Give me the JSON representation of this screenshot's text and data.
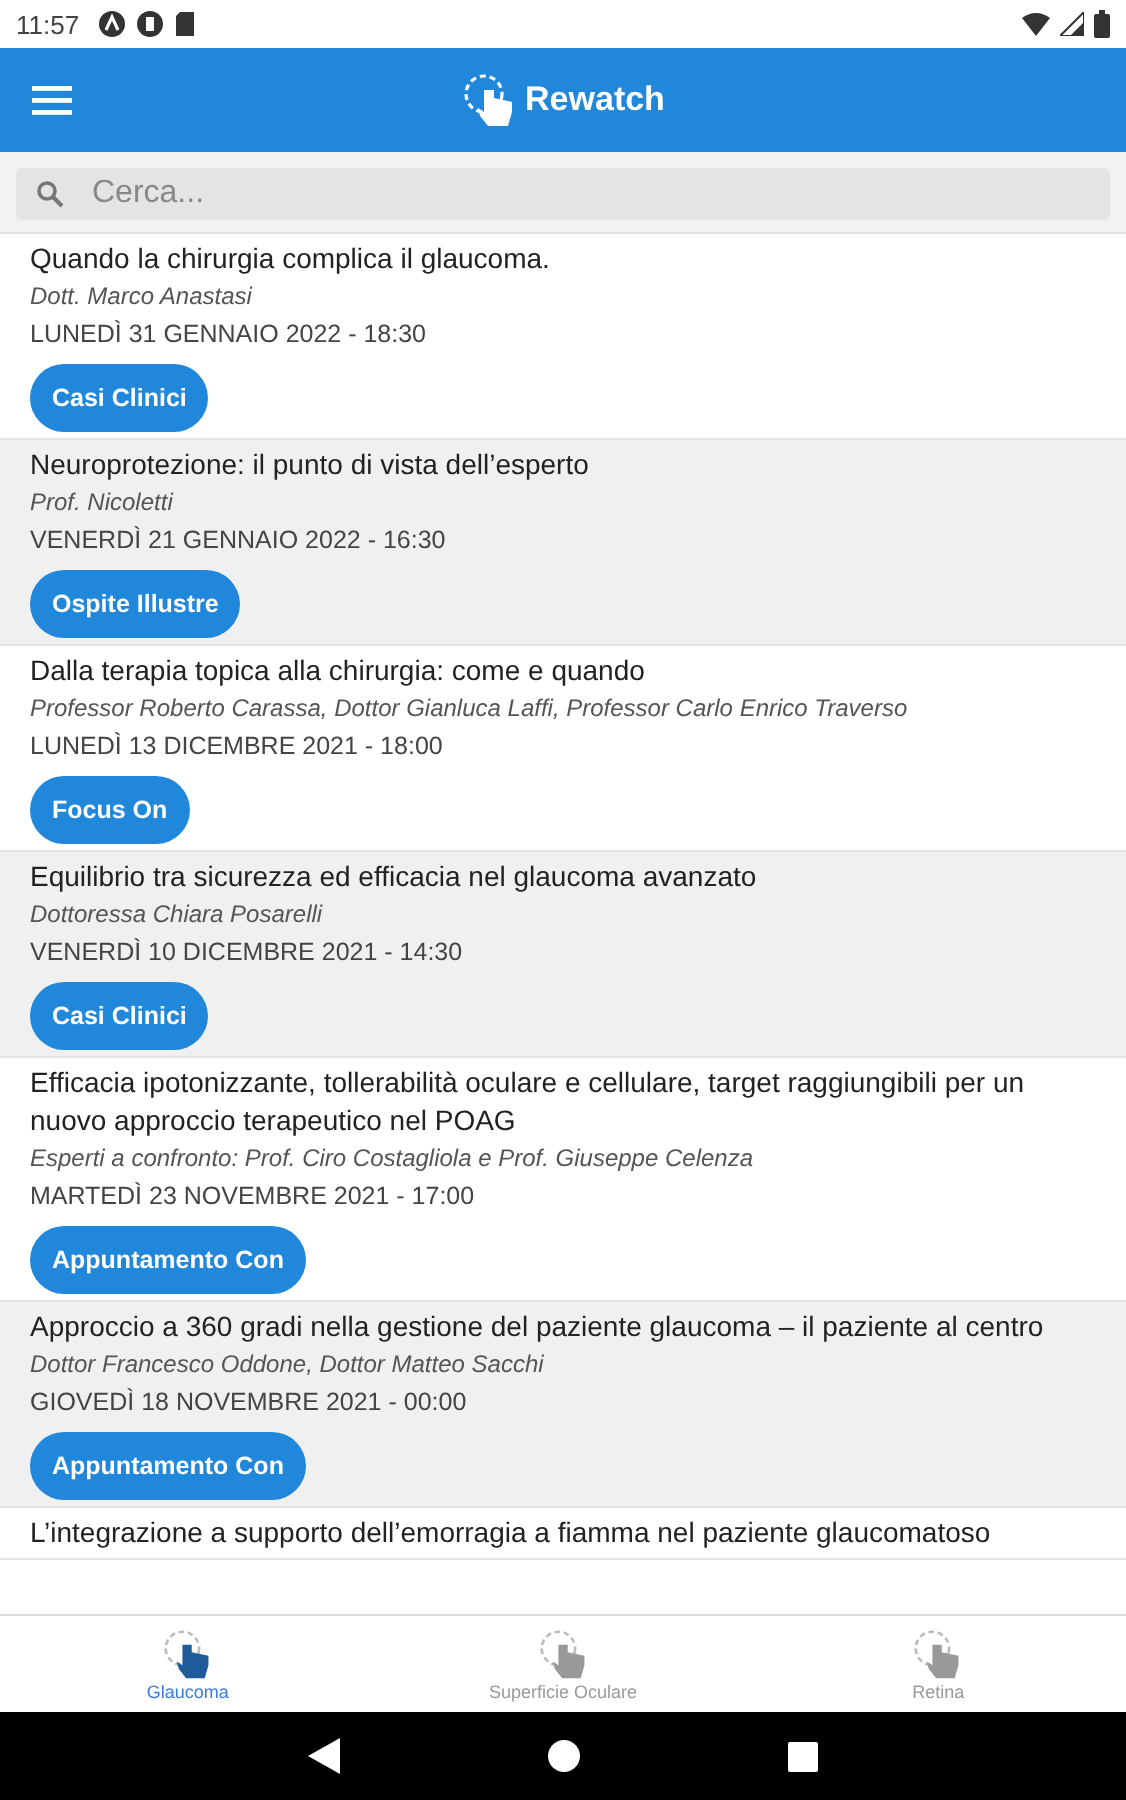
{
  "status_bar": {
    "time": "11:57"
  },
  "app_bar": {
    "title": "Rewatch"
  },
  "search": {
    "placeholder": "Cerca..."
  },
  "events": [
    {
      "title": "Quando la chirurgia complica il glaucoma.",
      "speaker": "Dott. Marco Anastasi",
      "date": "LUNEDÌ 31 GENNAIO 2022 - 18:30",
      "tag": "Casi Clinici"
    },
    {
      "title": "Neuroprotezione: il punto di vista dell’esperto",
      "speaker": "Prof. Nicoletti",
      "date": "VENERDÌ 21 GENNAIO 2022 - 16:30",
      "tag": "Ospite Illustre"
    },
    {
      "title": "Dalla terapia topica alla chirurgia: come e quando",
      "speaker": "Professor Roberto Carassa, Dottor Gianluca Laffi, Professor Carlo Enrico Traverso",
      "date": "LUNEDÌ 13 DICEMBRE 2021 - 18:00",
      "tag": "Focus On"
    },
    {
      "title": "Equilibrio tra sicurezza ed efficacia nel glaucoma avanzato",
      "speaker": "Dottoressa Chiara Posarelli",
      "date": "VENERDÌ 10 DICEMBRE 2021 - 14:30",
      "tag": "Casi Clinici"
    },
    {
      "title": "Efficacia ipotonizzante, tollerabilità oculare e cellulare, target raggiungibili per un nuovo approccio terapeutico nel POAG",
      "speaker": "Esperti a confronto: Prof. Ciro Costagliola e Prof. Giuseppe Celenza",
      "date": "MARTEDÌ 23 NOVEMBRE 2021 - 17:00",
      "tag": "Appuntamento Con"
    },
    {
      "title": "Approccio a 360 gradi nella gestione del paziente glaucoma – il paziente al centro",
      "speaker": "Dottor Francesco Oddone, Dottor Matteo Sacchi",
      "date": "GIOVEDÌ 18 NOVEMBRE 2021 - 00:00",
      "tag": "Appuntamento Con"
    },
    {
      "title": "L’integrazione a supporto dell’emorragia a fiamma nel paziente glaucomatoso"
    }
  ],
  "tabs": [
    {
      "label": "Glaucoma",
      "selected": true
    },
    {
      "label": "Superficie Oculare",
      "selected": false
    },
    {
      "label": "Retina",
      "selected": false
    }
  ]
}
